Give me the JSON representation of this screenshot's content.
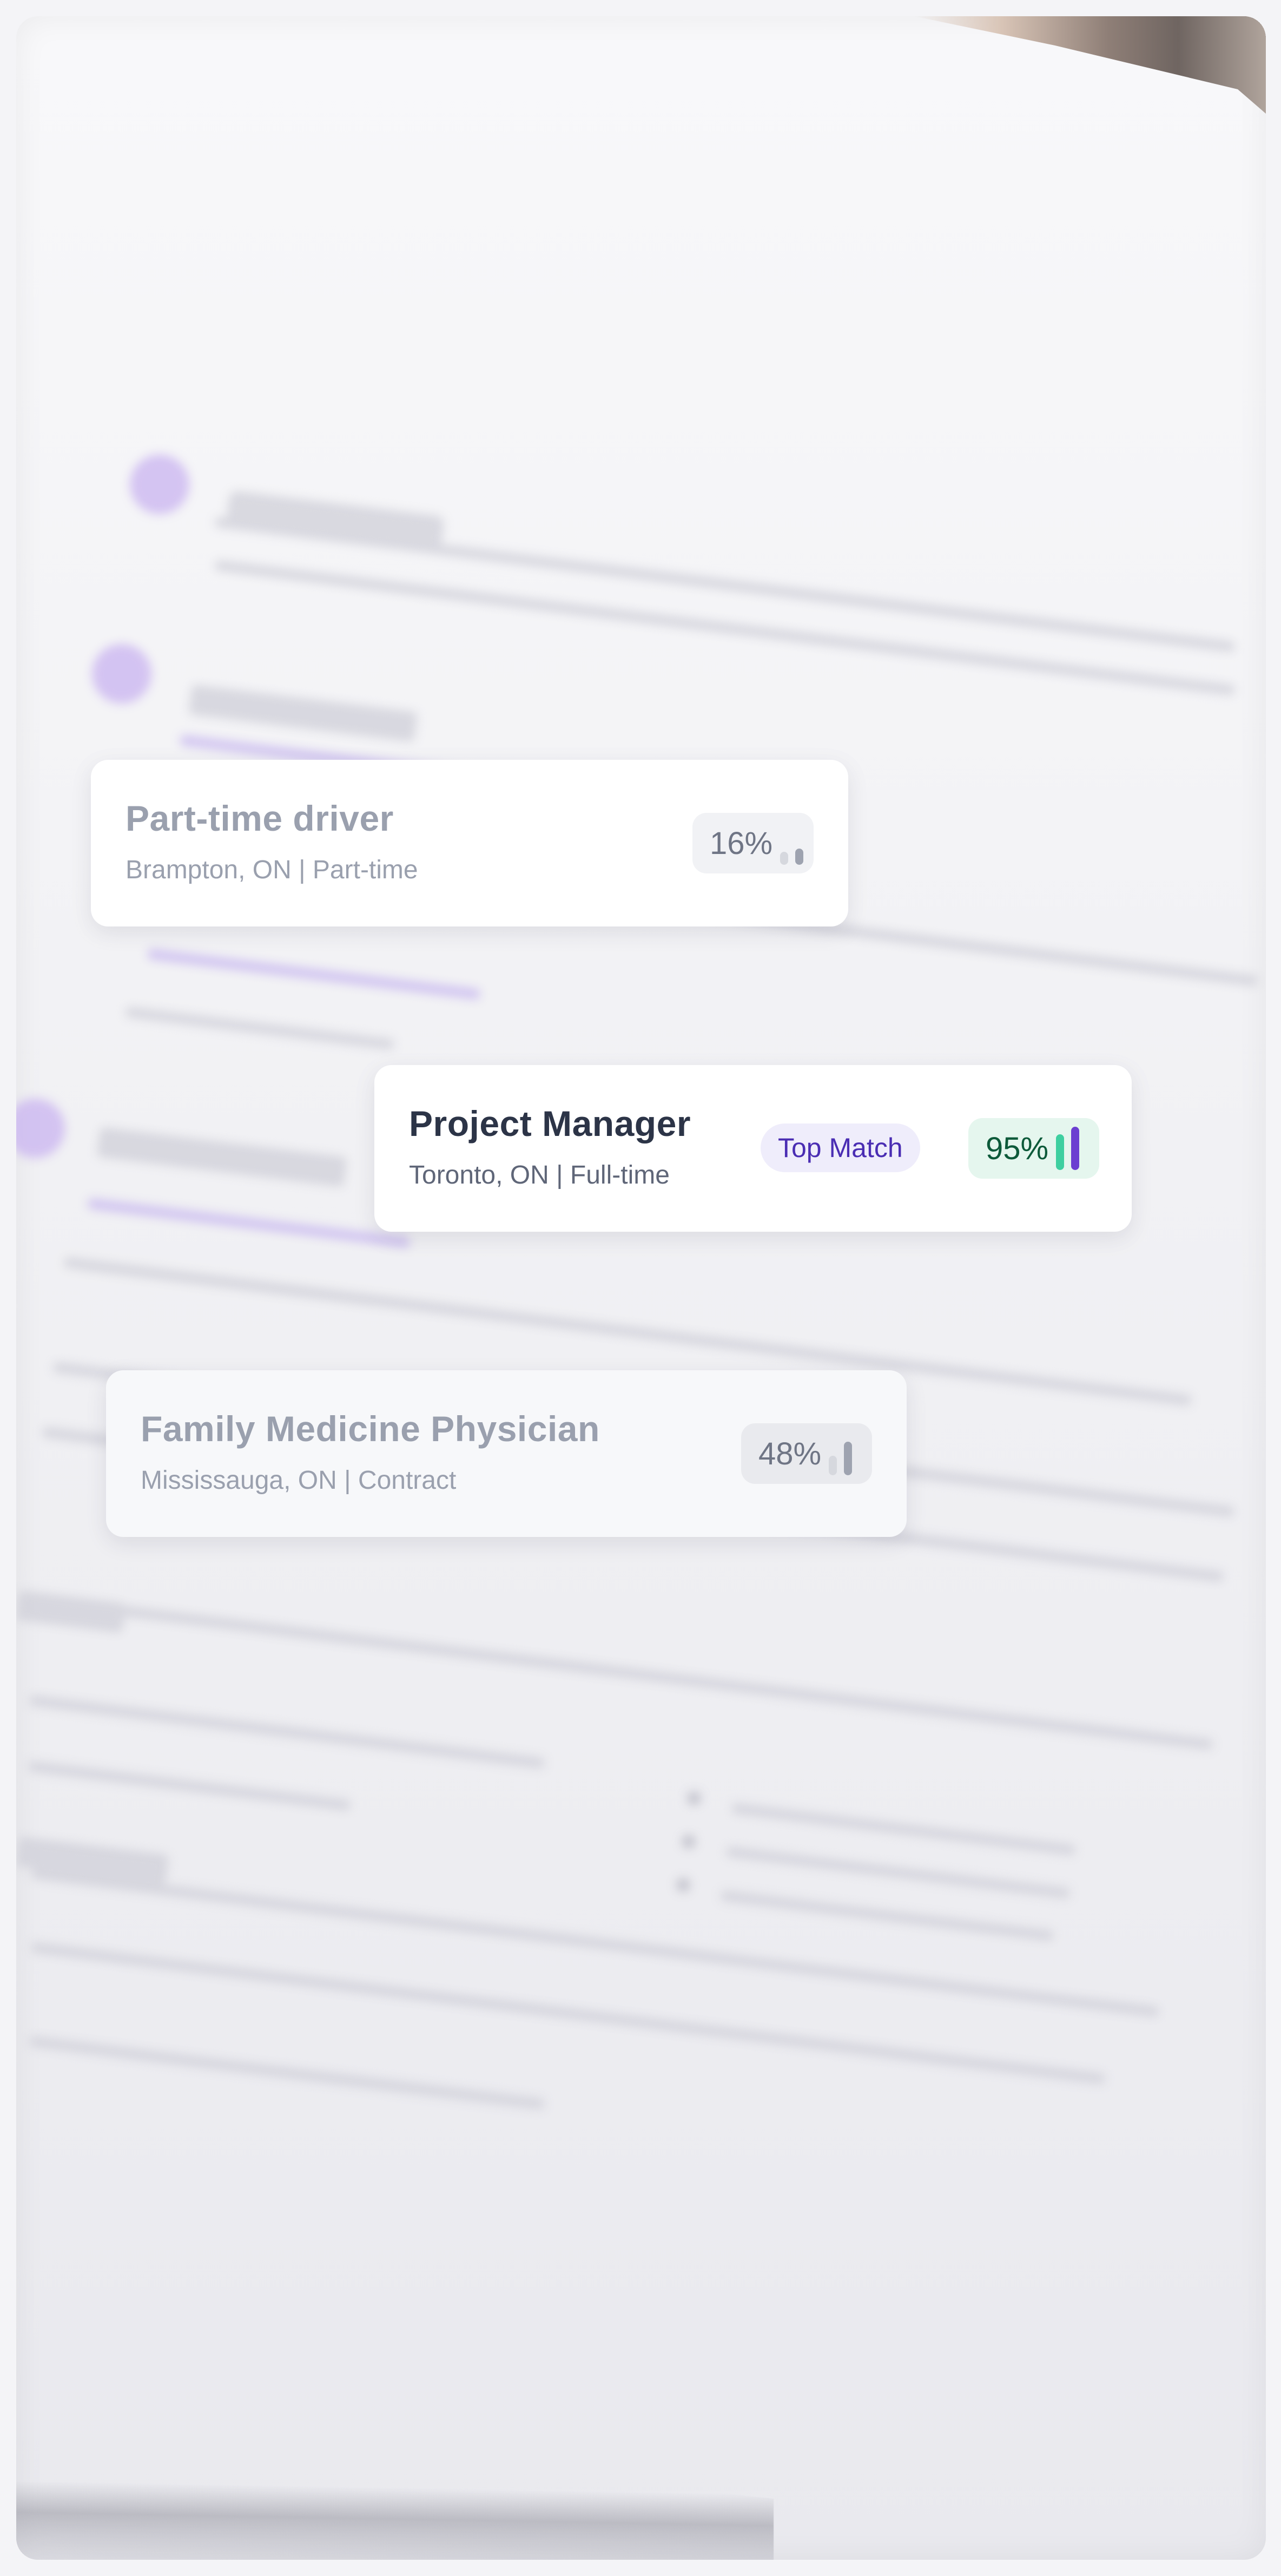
{
  "job_matches": [
    {
      "title": "Part-time driver",
      "meta": "Brampton, ON | Part-time",
      "match_percent": "16%",
      "match_value": 16,
      "badge": ""
    },
    {
      "title": "Project Manager",
      "meta": "Toronto, ON | Full-time",
      "match_percent": "95%",
      "match_value": 95,
      "badge": "Top Match"
    },
    {
      "title": "Family Medicine Physician",
      "meta": "Mississauga, ON | Contract",
      "match_percent": "48%",
      "match_value": 48,
      "badge": ""
    }
  ],
  "colors": {
    "accent_purple": "#6b3fd1",
    "match_green": "#3ecfa0",
    "badge_text": "#4a2db3",
    "muted_bar": "#c5c8d1",
    "mid_bar": "#9ea3b0"
  }
}
